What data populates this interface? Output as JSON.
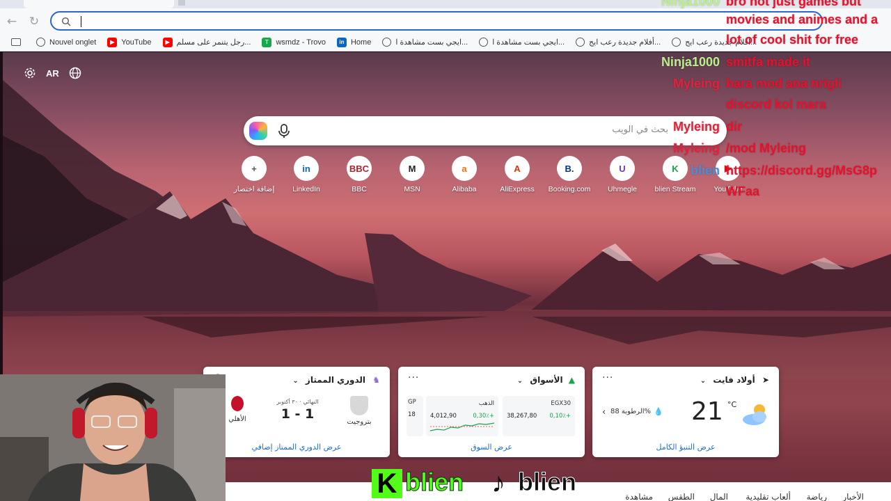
{
  "browser": {
    "address_value": "",
    "bookmarks": [
      {
        "label": "",
        "icon": "reading-list-icon"
      },
      {
        "label": "Nouvel onglet",
        "icon": "globe-icon"
      },
      {
        "label": "YouTube",
        "icon": "youtube-icon"
      },
      {
        "label": "رجل يتنمر على مسلم...",
        "icon": "youtube-icon"
      },
      {
        "label": "wsmdz - Trovo",
        "icon": "trovo-icon"
      },
      {
        "label": "Home",
        "icon": "linkedin-icon"
      },
      {
        "label": "ايجي بست مشاهدة ا...",
        "icon": "globe-icon"
      },
      {
        "label": "ايجي بست مشاهدة ا...",
        "icon": "globe-icon"
      },
      {
        "label": "أفلام جديدة رعب ايج...",
        "icon": "globe-icon"
      },
      {
        "label": "أفلام جديدة رعب ايج...",
        "icon": "globe-icon"
      }
    ]
  },
  "newtab": {
    "lang_label": "AR",
    "search_placeholder": "بحث في الويب",
    "quick_links": [
      {
        "label": "إضافة اختصار",
        "glyph": "+",
        "color": "#555555"
      },
      {
        "label": "LinkedIn",
        "glyph": "in",
        "color": "#0a66c2"
      },
      {
        "label": "BBC",
        "glyph": "BBC",
        "color": "#b3202a"
      },
      {
        "label": "MSN",
        "glyph": "M",
        "color": "#222222"
      },
      {
        "label": "Alibaba",
        "glyph": "a",
        "color": "#ff6a00"
      },
      {
        "label": "AliExpress",
        "glyph": "A",
        "color": "#e62e04"
      },
      {
        "label": "Booking.com",
        "glyph": "B.",
        "color": "#003580"
      },
      {
        "label": "Uhmegle",
        "glyph": "U",
        "color": "#6a3cbc"
      },
      {
        "label": "blien Stream",
        "glyph": "K",
        "color": "#16a34a"
      },
      {
        "label": "YouTube",
        "glyph": "▶",
        "color": "#ff0000"
      }
    ]
  },
  "chat": [
    {
      "name": "Ninja1000",
      "message": "bro not just games but"
    },
    {
      "name": "",
      "message": "movies and animes and a"
    },
    {
      "name": "",
      "message": "lot of cool shit for free"
    },
    {
      "name": "Ninja1000",
      "message": "smitfa made it"
    },
    {
      "name": "Myleing",
      "message": "hara mod ana nrigli"
    },
    {
      "name": "",
      "message": "discord kol mara"
    },
    {
      "name": "Myleing",
      "message": "dir"
    },
    {
      "name": "Myleing",
      "message": "/mod Myleing"
    },
    {
      "name": "blien",
      "message": "https://discord.gg/MsG8p"
    },
    {
      "name": "",
      "message": "WFaa"
    }
  ],
  "cards": {
    "league": {
      "title": "الدوري الممتاز",
      "home_team": "بتروجيت",
      "away_team": "الأهلي",
      "score": "1 - 1",
      "status": "النهائي · ٣٠ أكتوبر",
      "footer": "عرض الدوري الممتاز إضافي"
    },
    "markets": {
      "title": "الأسواق",
      "items": [
        {
          "name": "EGX30",
          "value": "38,267,80",
          "change": "0,10٪+"
        },
        {
          "name": "الذهب",
          "value": "4,012,90",
          "change": "0,30٪+"
        },
        {
          "name": "GP",
          "value": "18",
          "change": ""
        }
      ],
      "footer": "عرض السوق"
    },
    "weather": {
      "location": "أولاد فايت",
      "temp": "21",
      "unit": "°C",
      "humidity": "الرطوبة 88%",
      "footer": "عرض التنبؤ الكامل"
    }
  },
  "news_nav": [
    "الأخبار",
    "رياضة",
    "ألعاب تقليدية",
    "المال",
    "الطقس",
    "مشاهدة"
  ],
  "stream_brand": {
    "name": "blien"
  }
}
